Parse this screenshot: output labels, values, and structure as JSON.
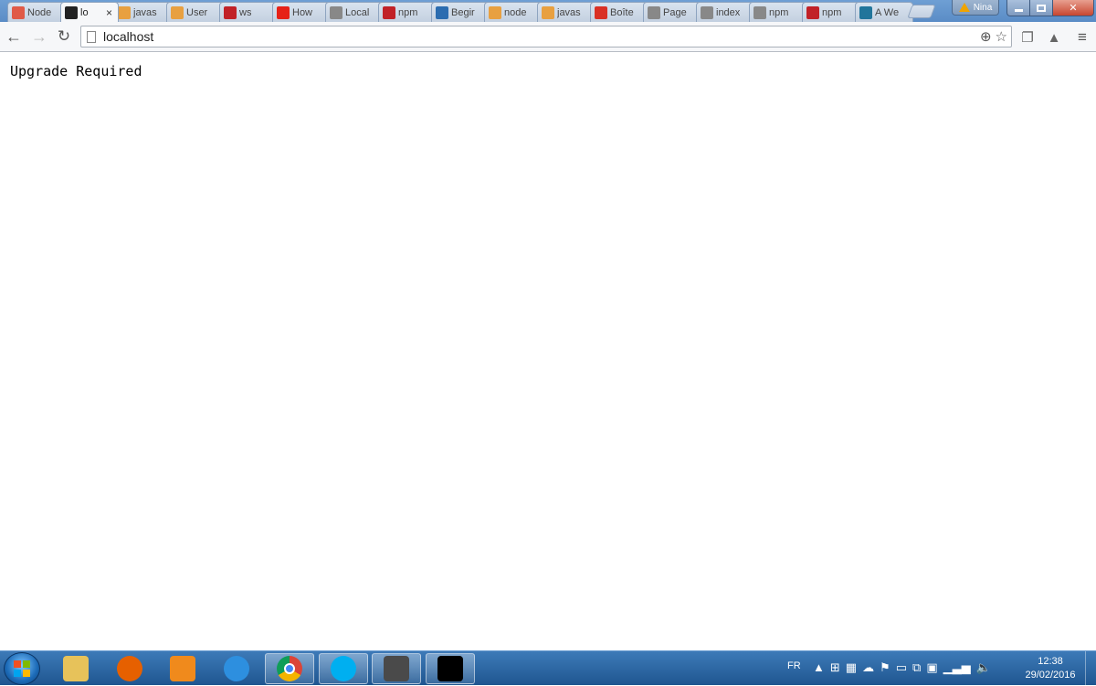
{
  "browser": {
    "tabs": [
      {
        "label": "Node",
        "icon": "red-cross-icon",
        "color": "#e05a47"
      },
      {
        "label": "lo",
        "icon": "star-icon",
        "color": "#222222",
        "active": true,
        "close": "×"
      },
      {
        "label": "javas",
        "icon": "stack-icon",
        "color": "#e8a040"
      },
      {
        "label": "User",
        "icon": "stack-icon",
        "color": "#e8a040"
      },
      {
        "label": "ws",
        "icon": "npm-icon",
        "color": "#c12127"
      },
      {
        "label": "How",
        "icon": "youtube-icon",
        "color": "#e62117"
      },
      {
        "label": "Local",
        "icon": "page-icon",
        "color": "#888888"
      },
      {
        "label": "npm",
        "icon": "npm-icon",
        "color": "#c12127"
      },
      {
        "label": "Begir",
        "icon": "h-icon",
        "color": "#2b6cb0"
      },
      {
        "label": "node",
        "icon": "stack-icon",
        "color": "#e8a040"
      },
      {
        "label": "javas",
        "icon": "stack-icon",
        "color": "#e8a040"
      },
      {
        "label": "Boîte",
        "icon": "gmail-icon",
        "color": "#d93025"
      },
      {
        "label": "Page",
        "icon": "page-icon",
        "color": "#888888"
      },
      {
        "label": "index",
        "icon": "page-icon",
        "color": "#888888"
      },
      {
        "label": "npm",
        "icon": "page-icon",
        "color": "#888888"
      },
      {
        "label": "npm",
        "icon": "npm-icon",
        "color": "#c12127"
      },
      {
        "label": "A We",
        "icon": "wordpress-icon",
        "color": "#21759b"
      }
    ],
    "profile_name": "Nina",
    "address": "localhost"
  },
  "page": {
    "body_text": "Upgrade Required"
  },
  "taskbar": {
    "pinned": [
      {
        "name": "explorer",
        "icon": "folder-icon",
        "color": "#e7c25a",
        "open": false
      },
      {
        "name": "firefox",
        "icon": "firefox-icon",
        "color": "#e66000",
        "open": false
      },
      {
        "name": "media-player",
        "icon": "media-player-icon",
        "color": "#f08a1c",
        "open": false
      },
      {
        "name": "internet-explorer",
        "icon": "ie-icon",
        "color": "#2d8fdf",
        "open": false
      },
      {
        "name": "chrome",
        "icon": "chrome-icon",
        "color": "#db4437",
        "open": true
      },
      {
        "name": "skype",
        "icon": "skype-icon",
        "color": "#00aff0",
        "open": true
      },
      {
        "name": "sublime-text",
        "icon": "sublime-icon",
        "color": "#4a4a4a",
        "open": true
      },
      {
        "name": "cmd",
        "icon": "terminal-icon",
        "color": "#000000",
        "open": true
      }
    ],
    "language": "FR",
    "time": "12:38",
    "date": "29/02/2016"
  }
}
